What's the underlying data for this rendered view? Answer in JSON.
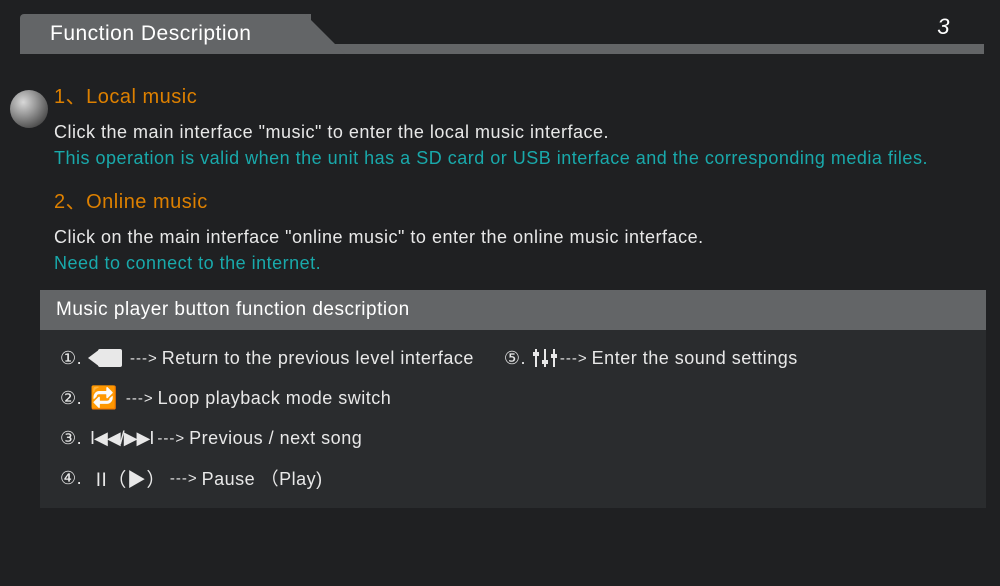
{
  "header": {
    "title": "Function Description",
    "page_number": "3"
  },
  "sections": [
    {
      "heading": "1、Local music",
      "body": "Click the main interface \"music\" to enter the local music interface.",
      "note": "This operation is valid when the unit has a SD card or USB interface and the corresponding media files."
    },
    {
      "heading": "2、Online music",
      "body": "Click on the main interface \"online music\" to enter the online music interface.",
      "note": "Need to connect to the internet."
    }
  ],
  "panel": {
    "title": "Music player button function description",
    "arrow": "--->",
    "items": [
      {
        "num": "①.",
        "icon": "back-icon",
        "desc": "Return to the previous level interface"
      },
      {
        "num": "②.",
        "icon": "loop-icon",
        "desc": "Loop playback mode switch"
      },
      {
        "num": "③.",
        "icon": "prev-next-icon",
        "desc": "Previous / next song"
      },
      {
        "num": "④.",
        "icon": "pause-play-icon",
        "desc": "Pause （Play)"
      },
      {
        "num": "⑤.",
        "icon": "equalizer-icon",
        "desc": "Enter the sound settings"
      }
    ]
  }
}
